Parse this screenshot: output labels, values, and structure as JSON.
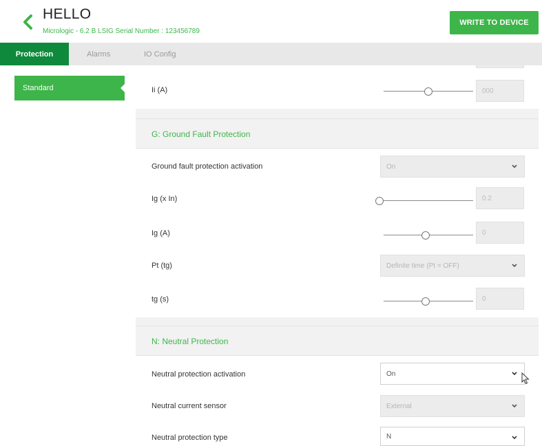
{
  "header": {
    "title": "HELLO",
    "subtitle": "Micrologic - 6.2 B LSIG Serial Number : 123456789",
    "write_button": "WRITE TO DEVICE",
    "accent_color": "#3db54a"
  },
  "tabs": [
    {
      "label": "Protection",
      "active": true
    },
    {
      "label": "Alarms",
      "active": false
    },
    {
      "label": "IO Config",
      "active": false
    }
  ],
  "sidebar": {
    "items": [
      {
        "label": "Standard",
        "selected": true
      }
    ]
  },
  "main": {
    "top_rows": [
      {
        "label": "Ii (A)",
        "value": "000",
        "slider_level": 0.5
      }
    ],
    "ground_fault": {
      "title": "G: Ground Fault Protection",
      "rows": [
        {
          "label": "Ground fault protection activation",
          "value": "On"
        },
        {
          "label": "Ig (x In)",
          "value": "0.2",
          "slider_level": 0.0
        },
        {
          "label": "Ig (A)",
          "value": "0",
          "slider_level": 0.5
        },
        {
          "label": "Pt (tg)",
          "value": "Definite time (Pt = OFF)"
        },
        {
          "label": "tg (s)",
          "value": "0",
          "slider_level": 0.5
        }
      ]
    },
    "neutral": {
      "title": "N: Neutral Protection",
      "rows": [
        {
          "label": "Neutral protection activation",
          "value": "On"
        },
        {
          "label": "Neutral current sensor",
          "value": "External"
        },
        {
          "label": "Neutral protection type",
          "value": "N"
        }
      ]
    }
  },
  "icons": {
    "back": "chevron-left-icon",
    "dropdown": "chevron-down-icon",
    "pointer": "mouse-pointer-icon"
  }
}
